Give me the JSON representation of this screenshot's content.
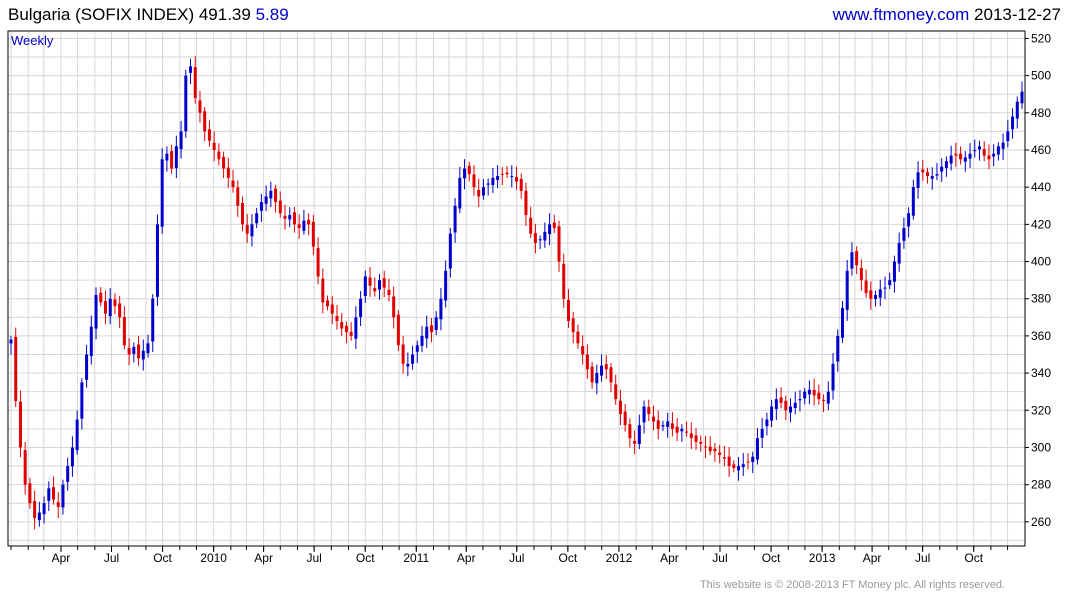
{
  "header": {
    "title": "Bulgaria (SOFIX INDEX)",
    "last": "491.39",
    "change": "5.89",
    "site": "www.ftmoney.com",
    "date": "2013-12-27"
  },
  "footer": {
    "text": "This website is © 2008-2013 FT Money plc. All rights reserved."
  },
  "colors": {
    "up": "#0000cc",
    "down": "#e00000",
    "grid": "#d6d6d6",
    "axis": "#000000",
    "label": "#0000cc"
  },
  "chart_data": {
    "type": "candlestick",
    "period_label": "Weekly",
    "x_tick_labels": [
      "Apr",
      "Jul",
      "Oct",
      "2010",
      "Apr",
      "Jul",
      "Oct",
      "2011",
      "Apr",
      "Jul",
      "Oct",
      "2012",
      "Apr",
      "Jul",
      "Oct",
      "2013",
      "Apr",
      "Jul",
      "Oct"
    ],
    "y_tick_labels": [
      "260",
      "280",
      "300",
      "320",
      "340",
      "360",
      "380",
      "400",
      "420",
      "440",
      "460",
      "480",
      "500",
      "520"
    ],
    "ylim": [
      247,
      524
    ],
    "grid": true,
    "x_start": "2009-01",
    "x_end": "2013-12-27",
    "closes": [
      358,
      325,
      300,
      280,
      270,
      262,
      265,
      270,
      278,
      272,
      268,
      280,
      290,
      300,
      315,
      335,
      350,
      365,
      382,
      378,
      372,
      380,
      376,
      370,
      355,
      350,
      354,
      348,
      352,
      356,
      380,
      420,
      455,
      458,
      450,
      462,
      470,
      500,
      505,
      488,
      480,
      470,
      465,
      460,
      455,
      450,
      445,
      440,
      430,
      420,
      415,
      420,
      426,
      432,
      435,
      438,
      432,
      426,
      423,
      425,
      420,
      418,
      422,
      420,
      408,
      392,
      378,
      376,
      372,
      368,
      364,
      362,
      360,
      370,
      380,
      392,
      387,
      384,
      390,
      386,
      382,
      370,
      355,
      345,
      345,
      350,
      355,
      360,
      365,
      362,
      370,
      380,
      395,
      415,
      430,
      445,
      450,
      447,
      440,
      435,
      440,
      442,
      445,
      446,
      447,
      447,
      446,
      443,
      438,
      425,
      415,
      410,
      412,
      416,
      420,
      418,
      400,
      380,
      368,
      362,
      356,
      350,
      342,
      335,
      340,
      344,
      342,
      335,
      326,
      318,
      312,
      305,
      302,
      312,
      322,
      318,
      314,
      310,
      312,
      314,
      310,
      308,
      310,
      308,
      305,
      303,
      302,
      300,
      298,
      298,
      296,
      294,
      290,
      289,
      290,
      291,
      292,
      295,
      305,
      310,
      315,
      322,
      326,
      324,
      320,
      322,
      324,
      326,
      330,
      331,
      328,
      326,
      325,
      330,
      345,
      360,
      375,
      395,
      405,
      398,
      390,
      383,
      380,
      382,
      385,
      386,
      390,
      400,
      410,
      418,
      426,
      440,
      448,
      448,
      446,
      446,
      447,
      451,
      454,
      457,
      457,
      455,
      456,
      458,
      460,
      462,
      457,
      455,
      458,
      462,
      464,
      470,
      478,
      486,
      491.39
    ]
  }
}
